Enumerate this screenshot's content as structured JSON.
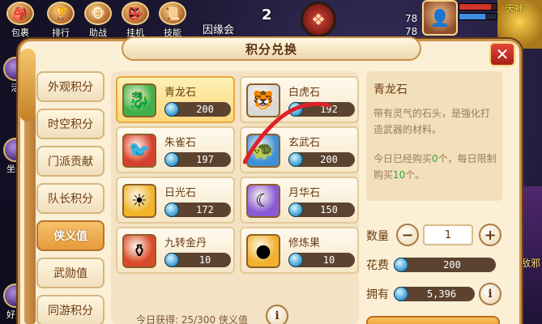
{
  "hud": {
    "buttons": [
      {
        "label": "包裹",
        "icon": "bag-icon",
        "glyph": "🎒"
      },
      {
        "label": "排行",
        "icon": "ranking-icon",
        "glyph": "🏆"
      },
      {
        "label": "助战",
        "icon": "helper-icon",
        "glyph": "🐵"
      },
      {
        "label": "挂机",
        "icon": "auto-battle-icon",
        "glyph": "👺"
      },
      {
        "label": "技能",
        "icon": "skill-icon",
        "glyph": "📜"
      }
    ],
    "side": [
      {
        "label": "活",
        "icon": "activity-icon"
      },
      {
        "label": "坐骑",
        "icon": "mount-icon"
      },
      {
        "label": "好友",
        "icon": "friends-icon"
      }
    ],
    "zone": "因缘会",
    "counter": "2",
    "lvl_a": "78",
    "lvl_b": "78",
    "boss_tag": "天神",
    "right_text": "敌邪"
  },
  "dialog": {
    "title": "积分兑换",
    "close_glyph": "✕"
  },
  "tabs": [
    "外观积分",
    "时空积分",
    "门派贡献",
    "队长积分",
    "侠义值",
    "武勋值",
    "同游积分"
  ],
  "active_tab": 4,
  "items": [
    {
      "name": "青龙石",
      "price": "200",
      "icon": "green-dragon-stone-icon",
      "glyph": "🐉",
      "bg": "#3fb04a"
    },
    {
      "name": "白虎石",
      "price": "192",
      "icon": "white-tiger-stone-icon",
      "glyph": "🐯",
      "bg": "#d9d9d9"
    },
    {
      "name": "朱雀石",
      "price": "197",
      "icon": "vermilion-bird-stone-icon",
      "glyph": "🐦",
      "bg": "#d8402e"
    },
    {
      "name": "玄武石",
      "price": "200",
      "icon": "black-tortoise-stone-icon",
      "glyph": "🐢",
      "bg": "#3f8fd6"
    },
    {
      "name": "日光石",
      "price": "172",
      "icon": "sunlight-stone-icon",
      "glyph": "☀",
      "bg": "#f0b42a"
    },
    {
      "name": "月华石",
      "price": "150",
      "icon": "moonlight-stone-icon",
      "glyph": "☾",
      "bg": "#8a5ad6"
    },
    {
      "name": "九转金丹",
      "price": "10",
      "icon": "golden-elixir-icon",
      "glyph": "⚱",
      "bg": "#d94a2a"
    },
    {
      "name": "修炼果",
      "price": "10",
      "icon": "cultivation-fruit-icon",
      "glyph": "●",
      "bg": "#f2b12c"
    }
  ],
  "selected_item": 0,
  "today_text": "今日获得: 25/300 侠义值",
  "info_glyph": "i",
  "detail": {
    "name": "青龙石",
    "desc": "带有灵气的石头，是强化打造武器的材料。",
    "limit_prefix": "今日已经购买",
    "limit_bought": "0",
    "limit_mid": "个，每日限制购买",
    "limit_max": "10",
    "limit_suffix": "个。"
  },
  "purchase": {
    "qty_label": "数量",
    "qty_value": "1",
    "minus": "−",
    "plus": "+",
    "cost_label": "花费",
    "cost_value": "200",
    "own_label": "拥有",
    "own_value": "5,396"
  }
}
